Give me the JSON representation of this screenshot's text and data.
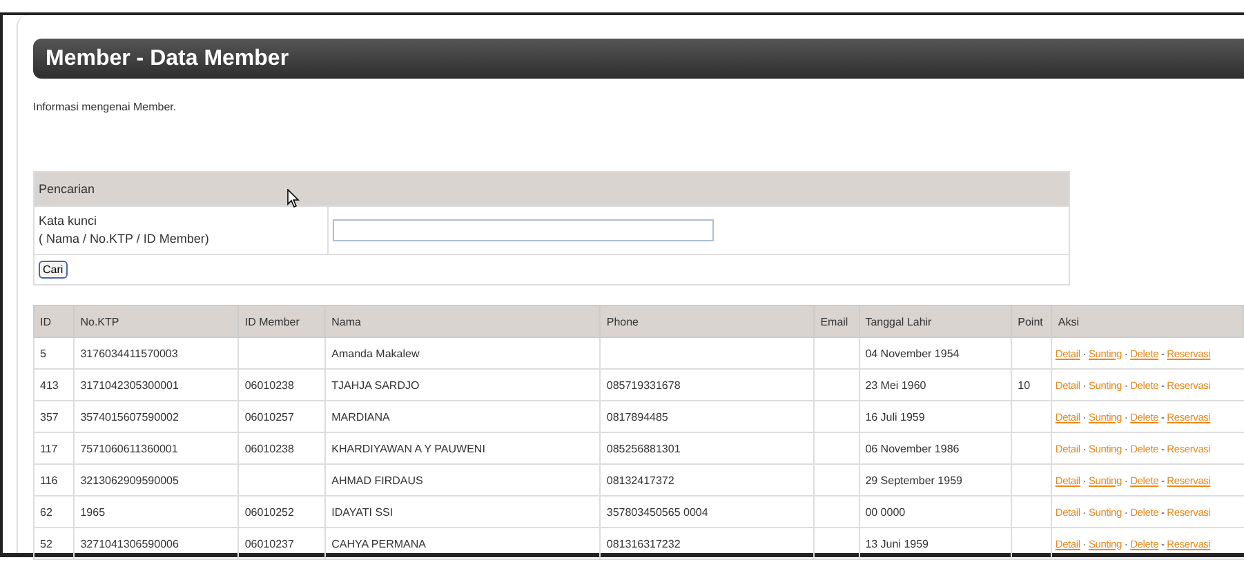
{
  "page": {
    "title": "Member - Data Member",
    "description": "Informasi mengenai Member."
  },
  "search": {
    "header": "Pencarian",
    "label": "Kata kunci",
    "hint": "( Nama / No.KTP / ID Member)",
    "button": "Cari"
  },
  "table": {
    "columns": [
      "ID",
      "No.KTP",
      "ID Member",
      "Nama",
      "Phone",
      "Email",
      "Tanggal Lahir",
      "Point",
      "Aksi"
    ],
    "rows": [
      {
        "id": "5",
        "ktp": "3176034411570003",
        "member_id": "",
        "name": "Amanda Makalew",
        "phone": "",
        "email": "",
        "birth": "04 November 1954",
        "point": "",
        "links_underlined": true,
        "actions": [
          {
            "kind": "link",
            "text": "Detail"
          },
          {
            "kind": "sep",
            "text": "·"
          },
          {
            "kind": "link",
            "text": "Sunting"
          },
          {
            "kind": "sep",
            "text": "·"
          },
          {
            "kind": "link",
            "text": "Delete"
          },
          {
            "kind": "sep",
            "text": "-"
          },
          {
            "kind": "link",
            "text": "Reservasi"
          }
        ]
      },
      {
        "id": "413",
        "ktp": "3171042305300001",
        "member_id": "06010238",
        "name": "TJAHJA SARDJO",
        "phone": "085719331678",
        "email": "",
        "birth": "23 Mei 1960",
        "point": "10",
        "links_underlined": false,
        "actions": [
          {
            "kind": "link",
            "text": "Detail"
          },
          {
            "kind": "sep",
            "text": "·"
          },
          {
            "kind": "link",
            "text": "Sunting"
          },
          {
            "kind": "sep",
            "text": "·"
          },
          {
            "kind": "link",
            "text": "Delete"
          },
          {
            "kind": "sep",
            "text": "-"
          },
          {
            "kind": "link",
            "text": "Reservasi"
          }
        ]
      },
      {
        "id": "357",
        "ktp": "3574015607590002",
        "member_id": "06010257",
        "name": "MARDIANA",
        "phone": "0817894485",
        "email": "",
        "birth": "16 Juli 1959",
        "point": "",
        "links_underlined": true,
        "actions": [
          {
            "kind": "link",
            "text": "Detail"
          },
          {
            "kind": "sep",
            "text": "·"
          },
          {
            "kind": "link",
            "text": "Sunting"
          },
          {
            "kind": "sep",
            "text": "·"
          },
          {
            "kind": "link",
            "text": "Delete"
          },
          {
            "kind": "sep",
            "text": "-"
          },
          {
            "kind": "link",
            "text": "Reservasi"
          }
        ]
      },
      {
        "id": "117",
        "ktp": "7571060611360001",
        "member_id": "06010238",
        "name": "KHARDIYAWAN A Y PAUWENI",
        "phone": "085256881301",
        "email": "",
        "birth": "06 November 1986",
        "point": "",
        "links_underlined": false,
        "actions": [
          {
            "kind": "link",
            "text": "Detail"
          },
          {
            "kind": "sep",
            "text": "·"
          },
          {
            "kind": "link",
            "text": "Sunting"
          },
          {
            "kind": "sep",
            "text": "·"
          },
          {
            "kind": "link",
            "text": "Delete"
          },
          {
            "kind": "sep",
            "text": "-"
          },
          {
            "kind": "link",
            "text": "Reservasi"
          }
        ]
      },
      {
        "id": "116",
        "ktp": "3213062909590005",
        "member_id": "",
        "name": "AHMAD FIRDAUS",
        "phone": "08132417372",
        "email": "",
        "birth": "29 September 1959",
        "point": "",
        "links_underlined": true,
        "actions": [
          {
            "kind": "link",
            "text": "Detail"
          },
          {
            "kind": "sep",
            "text": "·"
          },
          {
            "kind": "link",
            "text": "Sunting"
          },
          {
            "kind": "sep",
            "text": "·"
          },
          {
            "kind": "link",
            "text": "Delete"
          },
          {
            "kind": "sep",
            "text": "-"
          },
          {
            "kind": "link",
            "text": "Reservasi"
          }
        ]
      },
      {
        "id": "62",
        "ktp": "1965",
        "member_id": "06010252",
        "name": "IDAYATI SSI",
        "phone": "357803450565 0004",
        "email": "",
        "birth": "00 0000",
        "point": "",
        "links_underlined": false,
        "actions": [
          {
            "kind": "link",
            "text": "Detail"
          },
          {
            "kind": "sep",
            "text": "·"
          },
          {
            "kind": "link",
            "text": "Sunting"
          },
          {
            "kind": "sep",
            "text": "·"
          },
          {
            "kind": "link",
            "text": "Delete"
          },
          {
            "kind": "sep",
            "text": "-"
          },
          {
            "kind": "link",
            "text": "Reservasi"
          }
        ]
      },
      {
        "id": "52",
        "ktp": "3271041306590006",
        "member_id": "06010237",
        "name": "CAHYA PERMANA",
        "phone": "081316317232",
        "email": "",
        "birth": "13 Juni 1959",
        "point": "",
        "links_underlined": true,
        "actions": [
          {
            "kind": "link",
            "text": "Detail"
          },
          {
            "kind": "sep",
            "text": "·"
          },
          {
            "kind": "link",
            "text": "Sunting"
          },
          {
            "kind": "sep",
            "text": "·"
          },
          {
            "kind": "link",
            "text": "Delete"
          },
          {
            "kind": "sep",
            "text": "-"
          },
          {
            "kind": "link",
            "text": "Reservasi"
          }
        ]
      }
    ]
  }
}
